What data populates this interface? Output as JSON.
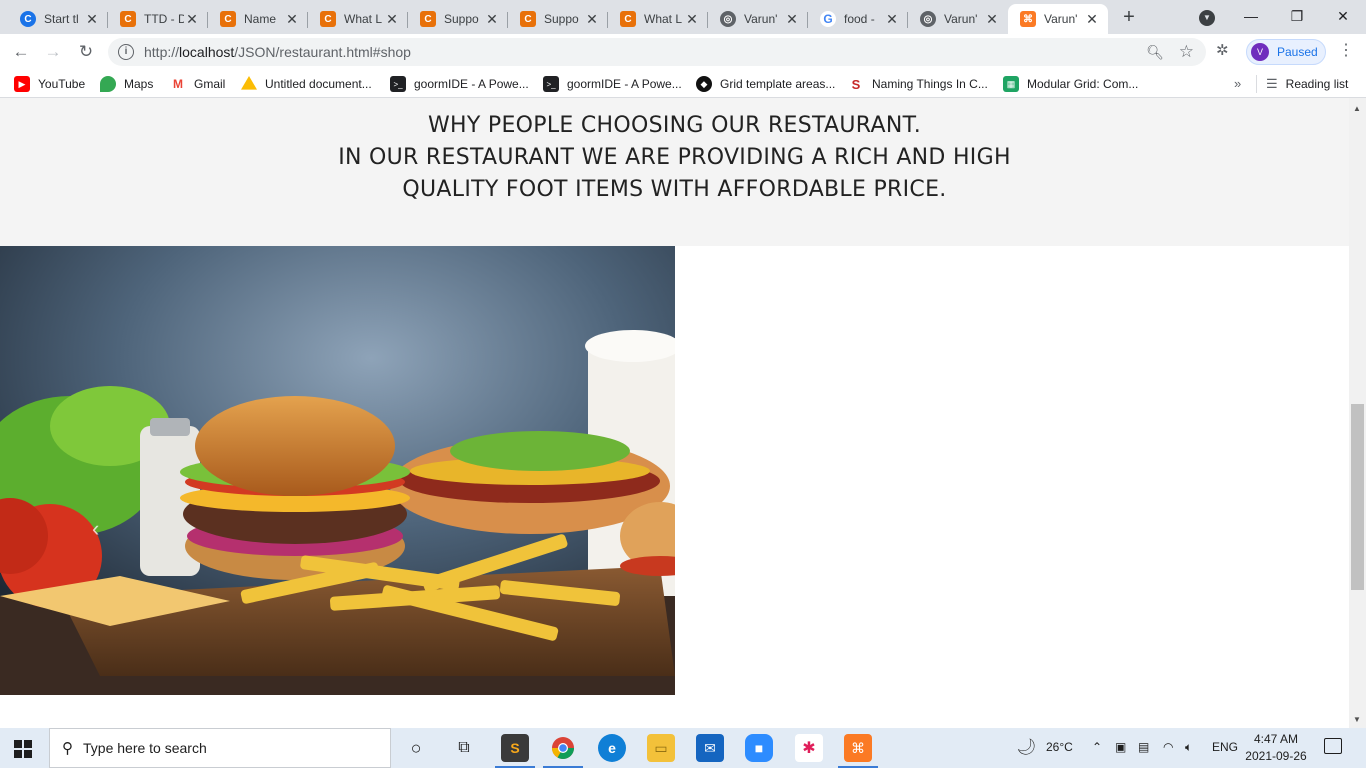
{
  "browser": {
    "tabs": [
      {
        "title": "Start tl",
        "favicon": "c-blue"
      },
      {
        "title": "TTD - D",
        "favicon": "c-orange"
      },
      {
        "title": "Name",
        "favicon": "c-orange"
      },
      {
        "title": "What L",
        "favicon": "c-orange"
      },
      {
        "title": "Suppo",
        "favicon": "c-orange"
      },
      {
        "title": "Suppo",
        "favicon": "c-orange"
      },
      {
        "title": "What L",
        "favicon": "c-orange"
      },
      {
        "title": "Varun'",
        "favicon": "globe"
      },
      {
        "title": "food -",
        "favicon": "google"
      },
      {
        "title": "Varun'",
        "favicon": "globe"
      },
      {
        "title": "Varun'",
        "favicon": "xampp",
        "active": true
      }
    ],
    "url_prefix": "http://",
    "url_host": "localhost",
    "url_path": "/JSON/restaurant.html#shop",
    "profile_initial": "V",
    "profile_status": "Paused"
  },
  "bookmarks": [
    {
      "label": "YouTube",
      "icon": "youtube-icon"
    },
    {
      "label": "Maps",
      "icon": "maps-icon"
    },
    {
      "label": "Gmail",
      "icon": "gmail-icon"
    },
    {
      "label": "Untitled document...",
      "icon": "drive-icon"
    },
    {
      "label": "goormIDE - A Powe...",
      "icon": "terminal-icon"
    },
    {
      "label": "goormIDE - A Powe...",
      "icon": "terminal-icon"
    },
    {
      "label": "Grid template areas...",
      "icon": "grid-icon"
    },
    {
      "label": "Naming Things In C...",
      "icon": "naming-icon"
    },
    {
      "label": "Modular Grid: Com...",
      "icon": "modular-icon"
    }
  ],
  "reading_list": "Reading list",
  "content": {
    "why_line1": "WHY PEOPLE CHOOSING OUR RESTAURANT.",
    "why_line2": "IN OUR RESTAURANT WE ARE PROVIDING A RICH AND HIGH",
    "why_line3": "QUALITY FOOT ITEMS WITH AFFORDABLE PRICE."
  },
  "taskbar": {
    "search_placeholder": "Type here to search",
    "weather": "26°C",
    "language": "ENG",
    "time": "4:47 AM",
    "date": "2021-09-26"
  }
}
